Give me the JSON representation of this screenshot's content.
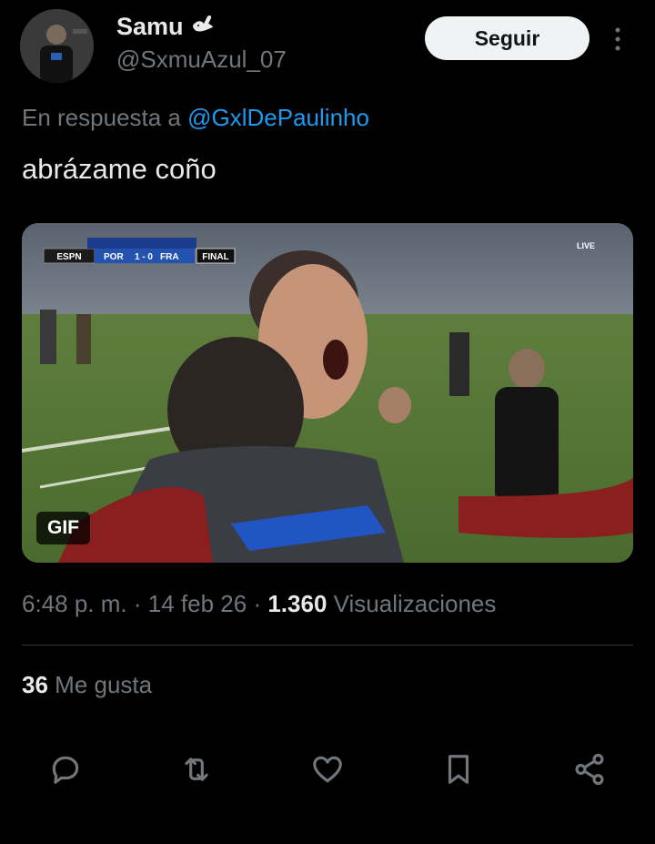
{
  "author": {
    "display_name": "Samu",
    "badge_icon": "dove-icon",
    "handle": "@SxmuAzul_07",
    "follow_label": "Seguir",
    "more_icon": "more-vertical-icon"
  },
  "reply": {
    "prefix": "En respuesta a",
    "mention": "@GxlDePaulinho"
  },
  "tweet": {
    "text": "abrázame coño"
  },
  "media": {
    "badge": "GIF",
    "scoreboard": {
      "broadcaster": "ESPN",
      "home": "POR",
      "score": "1 - 0",
      "away": "FRA",
      "status": "FINAL",
      "live_tag": "LIVE"
    }
  },
  "meta": {
    "time": "6:48 p. m.",
    "sep1": "·",
    "date": "14 feb 26",
    "sep2": "·",
    "views_count": "1.360",
    "views_label": "Visualizaciones"
  },
  "stats": {
    "likes_count": "36",
    "likes_label": "Me gusta"
  },
  "actions": [
    {
      "name": "reply",
      "icon": "reply-icon"
    },
    {
      "name": "retweet",
      "icon": "retweet-icon"
    },
    {
      "name": "like",
      "icon": "heart-icon"
    },
    {
      "name": "bookmark",
      "icon": "bookmark-icon"
    },
    {
      "name": "share",
      "icon": "share-icon"
    }
  ],
  "colors": {
    "background": "#000000",
    "text": "#e7e9ea",
    "muted": "#71767b",
    "link": "#1d9bf0",
    "follow_bg": "#eff3f4"
  }
}
